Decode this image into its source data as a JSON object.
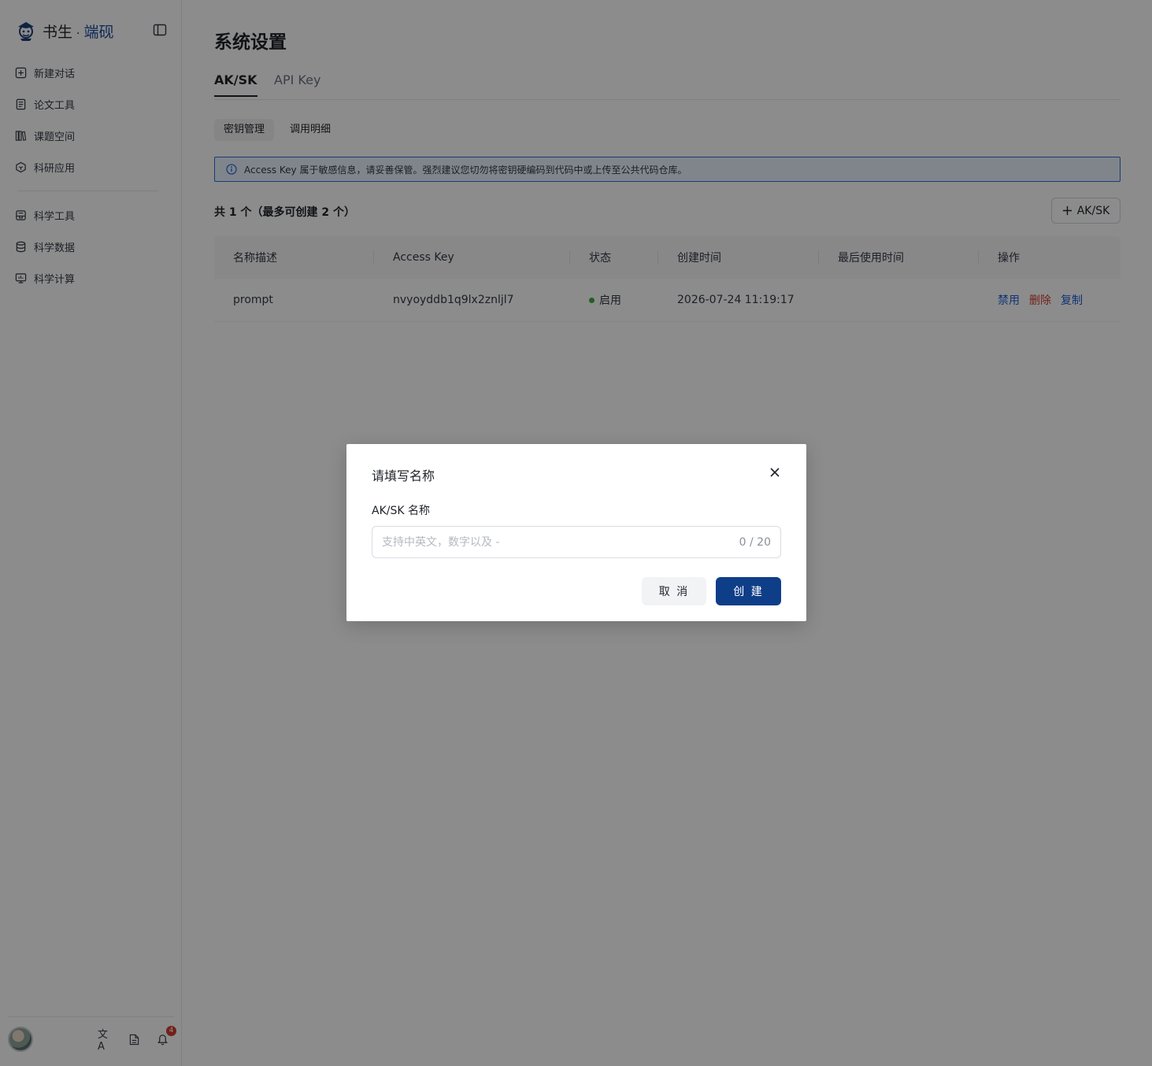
{
  "brand": {
    "name_primary": "书生",
    "separator": "·",
    "name_accent": "端砚"
  },
  "sidebar": {
    "items_top": [
      {
        "label": "新建对话",
        "icon": "plus-square-icon"
      },
      {
        "label": "论文工具",
        "icon": "document-icon"
      },
      {
        "label": "课题空间",
        "icon": "books-icon"
      },
      {
        "label": "科研应用",
        "icon": "cube-icon"
      }
    ],
    "items_bottom": [
      {
        "label": "科学工具",
        "icon": "toolbox-icon"
      },
      {
        "label": "科学数据",
        "icon": "database-icon"
      },
      {
        "label": "科学计算",
        "icon": "monitor-icon"
      }
    ],
    "footer": {
      "translate_glyph": "文A",
      "notification_count": "4"
    }
  },
  "page": {
    "title": "系统设置",
    "tabs": [
      {
        "label": "AK/SK",
        "active": true
      },
      {
        "label": "API Key",
        "active": false
      }
    ],
    "subtabs": [
      {
        "label": "密钥管理",
        "active": true
      },
      {
        "label": "调用明细",
        "active": false
      }
    ],
    "alert": "Access Key 属于敏感信息，请妥善保管。强烈建议您切勿将密钥硬编码到代码中或上传至公共代码仓库。",
    "count_text": "共 1 个（最多可创建 2 个）",
    "add_button": "AK/SK"
  },
  "table": {
    "columns": [
      "名称描述",
      "Access Key",
      "状态",
      "创建时间",
      "最后使用时间",
      "操作"
    ],
    "rows": [
      {
        "name": "prompt",
        "access_key": "nvyoyddb1q9lx2znljl7",
        "status": "启用",
        "created": "2026-07-24 11:19:17",
        "last_used": "",
        "actions": {
          "disable": "禁用",
          "delete": "删除",
          "copy": "复制"
        }
      }
    ]
  },
  "modal": {
    "title": "请填写名称",
    "field_label": "AK/SK 名称",
    "field_value": "",
    "placeholder": "支持中英文，数字以及 -",
    "counter": "0 / 20",
    "cancel": "取 消",
    "create": "创 建"
  },
  "colors": {
    "primary": "#0f3e88",
    "link": "#1d5fd6",
    "danger": "#d23a2f",
    "success": "#3fae3a",
    "alert_border": "#2e6fd8"
  }
}
